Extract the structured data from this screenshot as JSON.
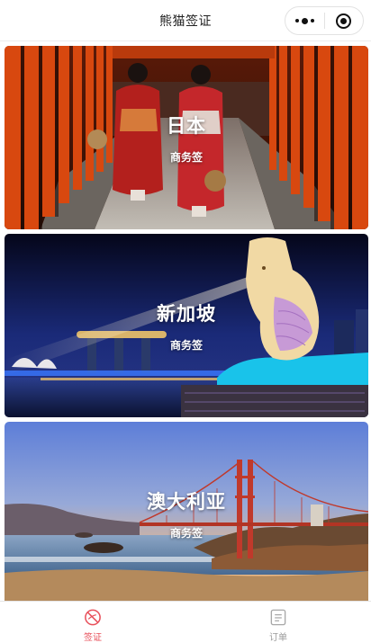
{
  "navbar": {
    "title": "熊猫签证",
    "menu_icon": "more-dots-icon",
    "close_icon": "target-circle-icon"
  },
  "cards": [
    {
      "country": "日本",
      "visa_type": "商务签",
      "image": "japan-torii-kimono-photo"
    },
    {
      "country": "新加坡",
      "visa_type": "商务签",
      "image": "singapore-merlion-night-photo"
    },
    {
      "country": "澳大利亚",
      "visa_type": "商务签",
      "image": "bridge-sunset-coast-photo"
    }
  ],
  "tabbar": {
    "tabs": [
      {
        "label": "签证",
        "icon": "visa-slash-icon",
        "active": true
      },
      {
        "label": "订单",
        "icon": "order-list-icon",
        "active": false
      }
    ],
    "active_color": "#e8505b",
    "inactive_color": "#9a9a9a"
  }
}
